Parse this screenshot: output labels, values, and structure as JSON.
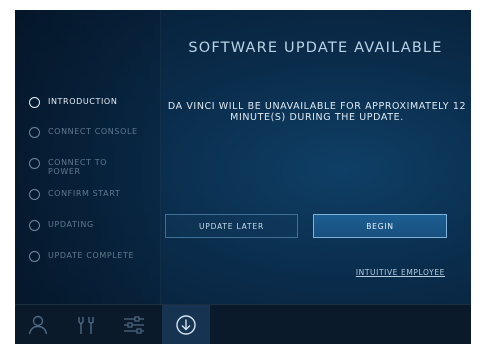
{
  "title": "SOFTWARE UPDATE AVAILABLE",
  "message": "DA VINCI WILL BE UNAVAILABLE FOR APPROXIMATELY 12 MINUTE(S) DURING THE UPDATE.",
  "steps": [
    {
      "label": "INTRODUCTION",
      "active": true
    },
    {
      "label": "CONNECT CONSOLE",
      "active": false
    },
    {
      "label": "CONNECT TO\nPOWER",
      "active": false
    },
    {
      "label": "CONFIRM START",
      "active": false
    },
    {
      "label": "UPDATING",
      "active": false
    },
    {
      "label": "UPDATE COMPLETE",
      "active": false
    }
  ],
  "buttons": {
    "update_later": "UPDATE LATER",
    "begin": "BEGIN"
  },
  "link": "INTUITIVE EMPLOYEE",
  "bottom_tabs": [
    {
      "icon": "user-icon",
      "active": false
    },
    {
      "icon": "tools-icon",
      "active": false
    },
    {
      "icon": "settings-sliders-icon",
      "active": false
    },
    {
      "icon": "download-icon",
      "active": true
    }
  ],
  "colors": {
    "background": "#0a2c4b",
    "accent": "#1d5e93",
    "text": "#dfe9f2"
  }
}
